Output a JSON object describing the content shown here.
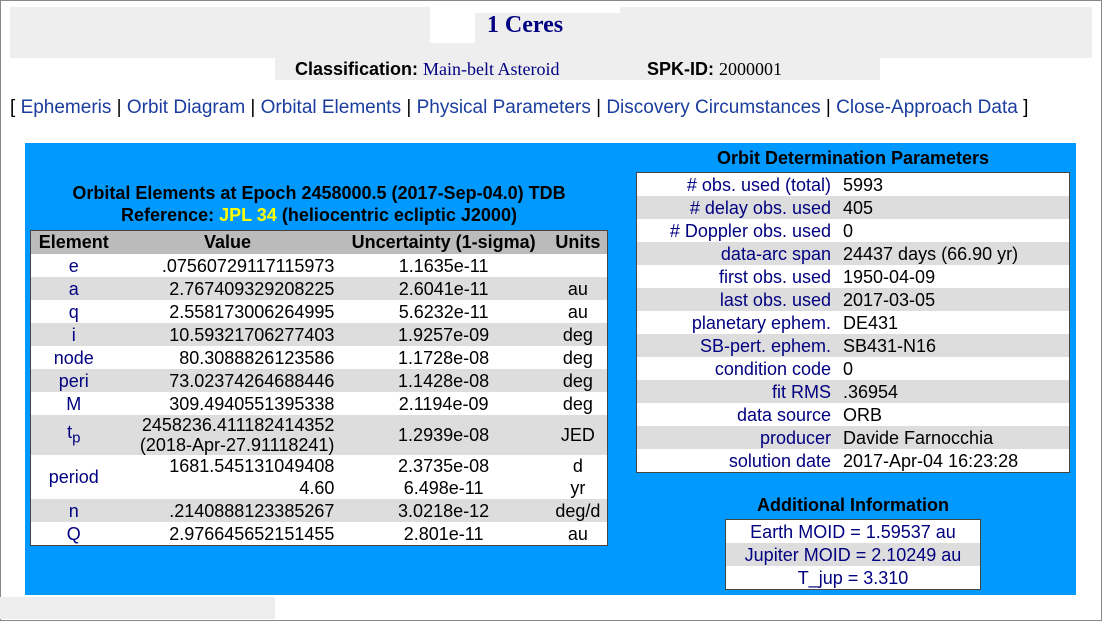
{
  "title": "1 Ceres",
  "classification": {
    "label": "Classification:",
    "value": "Main-belt Asteroid",
    "spk_label": "SPK-ID:",
    "spk_value": "2000001"
  },
  "nav": {
    "links": [
      "Ephemeris",
      "Orbit Diagram",
      "Orbital Elements",
      "Physical Parameters",
      "Discovery Circumstances",
      "Close-Approach Data"
    ]
  },
  "orbital_elements": {
    "title": "Orbital Elements at Epoch 2458000.5 (2017-Sep-04.0) TDB",
    "ref_prefix": "Reference:",
    "ref_value": "JPL 34",
    "ref_suffix": "(heliocentric ecliptic J2000)",
    "headers": [
      "Element",
      "Value",
      "Uncertainty (1-sigma)",
      "Units"
    ],
    "rows": [
      {
        "name": "e",
        "value": ".07560729117115973",
        "unc": "1.1635e-11",
        "units": ""
      },
      {
        "name": "a",
        "value": "2.767409329208225",
        "unc": "2.6041e-11",
        "units": "au"
      },
      {
        "name": "q",
        "value": "2.558173006264995",
        "unc": "5.6232e-11",
        "units": "au"
      },
      {
        "name": "i",
        "value": "10.59321706277403",
        "unc": "1.9257e-09",
        "units": "deg"
      },
      {
        "name": "node",
        "value": "80.3088826123586",
        "unc": "1.1728e-08",
        "units": "deg"
      },
      {
        "name": "peri",
        "value": "73.02374264688446",
        "unc": "1.1428e-08",
        "units": "deg"
      },
      {
        "name": "M",
        "value": "309.4940551395338",
        "unc": "2.1194e-09",
        "units": "deg"
      }
    ],
    "tp": {
      "name": "t",
      "sub": "p",
      "value1": "2458236.411182414352",
      "value2": "(2018-Apr-27.91118241)",
      "unc": "1.2939e-08",
      "units": "JED"
    },
    "period": {
      "name": "period",
      "value1": "1681.545131049408",
      "value2": "4.60",
      "unc1": "2.3735e-08",
      "unc2": "6.498e-11",
      "units1": "d",
      "units2": "yr"
    },
    "rows2": [
      {
        "name": "n",
        "value": ".2140888123385267",
        "unc": "3.0218e-12",
        "units": "deg/d"
      },
      {
        "name": "Q",
        "value": "2.976645652151455",
        "unc": "2.801e-11",
        "units": "au"
      }
    ]
  },
  "odp": {
    "title": "Orbit Determination Parameters",
    "rows": [
      {
        "label": "# obs. used (total)",
        "value": "5993"
      },
      {
        "label": "# delay obs. used",
        "value": "405"
      },
      {
        "label": "# Doppler obs. used",
        "value": "0"
      },
      {
        "label": "data-arc span",
        "value": "24437 days (66.90 yr)"
      },
      {
        "label": "first obs. used",
        "value": "1950-04-09"
      },
      {
        "label": "last obs. used",
        "value": "2017-03-05"
      },
      {
        "label": "planetary ephem.",
        "value": "DE431"
      },
      {
        "label": "SB-pert. ephem.",
        "value": "SB431-N16"
      },
      {
        "label": "condition code",
        "value": "0"
      },
      {
        "label": "fit RMS",
        "value": ".36954"
      },
      {
        "label": "data source",
        "value": "ORB"
      },
      {
        "label": "producer",
        "value": "Davide Farnocchia"
      },
      {
        "label": "solution date",
        "value": "2017-Apr-04 16:23:28"
      }
    ]
  },
  "additional": {
    "title": "Additional Information",
    "rows": [
      {
        "label": "Earth MOID",
        "value": "= 1.59537 au"
      },
      {
        "label": "Jupiter MOID",
        "value": "= 2.10249 au"
      },
      {
        "label": "T_jup",
        "value": "= 3.310"
      }
    ]
  }
}
